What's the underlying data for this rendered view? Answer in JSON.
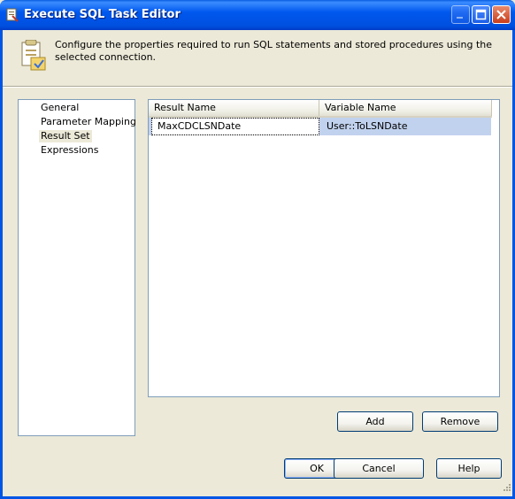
{
  "window": {
    "title": "Execute SQL Task Editor"
  },
  "header": {
    "description": "Configure the properties required to run SQL statements and stored procedures using the selected connection."
  },
  "nav": {
    "items": [
      {
        "label": "General",
        "selected": false
      },
      {
        "label": "Parameter Mapping",
        "selected": false
      },
      {
        "label": "Result Set",
        "selected": true
      },
      {
        "label": "Expressions",
        "selected": false
      }
    ]
  },
  "result_grid": {
    "columns": [
      "Result Name",
      "Variable Name"
    ],
    "rows": [
      [
        "MaxCDCLSNDate",
        "User::ToLSNDate"
      ]
    ]
  },
  "buttons": {
    "add": "Add",
    "remove": "Remove",
    "ok": "OK",
    "cancel": "Cancel",
    "help": "Help"
  },
  "colors": {
    "titlebar": "#0058ee",
    "dialog_background": "#ece9d8",
    "selected_row": "#c1d2ee"
  }
}
